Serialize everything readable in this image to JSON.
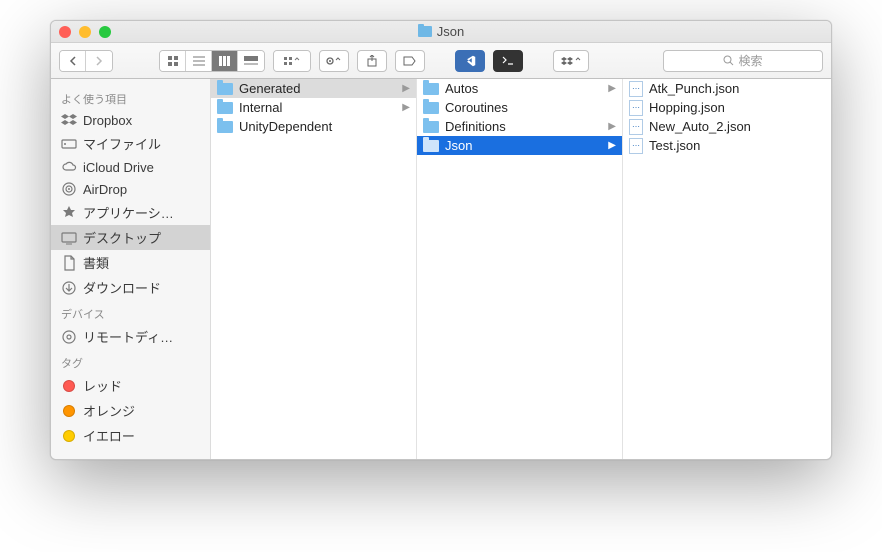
{
  "window": {
    "title": "Json"
  },
  "toolbar": {
    "search_placeholder": "検索"
  },
  "sidebar": {
    "sections": [
      {
        "header": "よく使う項目",
        "items": [
          {
            "icon": "dropbox-icon",
            "label": "Dropbox"
          },
          {
            "icon": "drive-icon",
            "label": "マイファイル"
          },
          {
            "icon": "cloud-icon",
            "label": "iCloud Drive"
          },
          {
            "icon": "airdrop-icon",
            "label": "AirDrop"
          },
          {
            "icon": "apps-icon",
            "label": "アプリケーシ…"
          },
          {
            "icon": "desktop-icon",
            "label": "デスクトップ",
            "selected": true
          },
          {
            "icon": "documents-icon",
            "label": "書類"
          },
          {
            "icon": "downloads-icon",
            "label": "ダウンロード"
          }
        ]
      },
      {
        "header": "デバイス",
        "items": [
          {
            "icon": "disc-icon",
            "label": "リモートディ…"
          }
        ]
      },
      {
        "header": "タグ",
        "items": [
          {
            "icon": "tag-dot",
            "color": "#ff5a52",
            "label": "レッド"
          },
          {
            "icon": "tag-dot",
            "color": "#ff9500",
            "label": "オレンジ"
          },
          {
            "icon": "tag-dot",
            "color": "#ffcc00",
            "label": "イエロー"
          }
        ]
      }
    ]
  },
  "columns": [
    {
      "items": [
        {
          "type": "folder",
          "label": "Generated",
          "expandable": true,
          "state": "path"
        },
        {
          "type": "folder",
          "label": "Internal",
          "expandable": true
        },
        {
          "type": "folder",
          "label": "UnityDependent"
        }
      ]
    },
    {
      "items": [
        {
          "type": "folder",
          "label": "Autos",
          "expandable": true
        },
        {
          "type": "folder",
          "label": "Coroutines"
        },
        {
          "type": "folder",
          "label": "Definitions",
          "expandable": true
        },
        {
          "type": "folder",
          "label": "Json",
          "expandable": true,
          "state": "selected"
        }
      ]
    },
    {
      "items": [
        {
          "type": "file",
          "label": "Atk_Punch.json"
        },
        {
          "type": "file",
          "label": "Hopping.json"
        },
        {
          "type": "file",
          "label": "New_Auto_2.json"
        },
        {
          "type": "file",
          "label": "Test.json"
        }
      ]
    }
  ]
}
